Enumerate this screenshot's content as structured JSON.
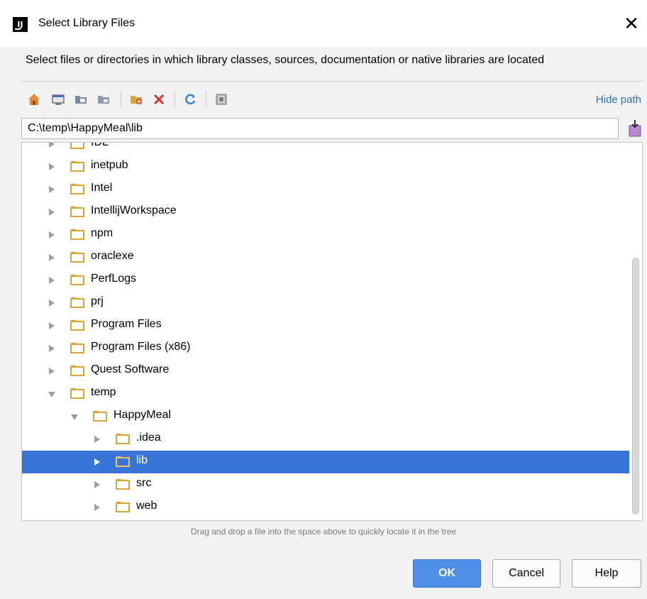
{
  "window": {
    "title": "Select Library Files",
    "app_icon_text": "IJ",
    "close_glyph": "✕"
  },
  "description": "Select files or directories in which library classes, sources, documentation or native libraries are located",
  "toolbar": {
    "icons": [
      "home-icon",
      "desktop-icon",
      "project-folder-icon",
      "module-folder-icon",
      "new-folder-icon",
      "delete-icon",
      "refresh-icon",
      "show-hidden-icon"
    ],
    "hide_path_label": "Hide path"
  },
  "path_field": {
    "value": "C:\\temp\\HappyMeal\\lib"
  },
  "tree": {
    "items": [
      {
        "label": "IDL",
        "level": 1,
        "state": "collapsed",
        "selected": false,
        "partial": true
      },
      {
        "label": "inetpub",
        "level": 1,
        "state": "collapsed",
        "selected": false
      },
      {
        "label": "Intel",
        "level": 1,
        "state": "collapsed",
        "selected": false
      },
      {
        "label": "IntellijWorkspace",
        "level": 1,
        "state": "collapsed",
        "selected": false
      },
      {
        "label": "npm",
        "level": 1,
        "state": "collapsed",
        "selected": false
      },
      {
        "label": "oraclexe",
        "level": 1,
        "state": "collapsed",
        "selected": false
      },
      {
        "label": "PerfLogs",
        "level": 1,
        "state": "collapsed",
        "selected": false
      },
      {
        "label": "prj",
        "level": 1,
        "state": "collapsed",
        "selected": false
      },
      {
        "label": "Program Files",
        "level": 1,
        "state": "collapsed",
        "selected": false
      },
      {
        "label": "Program Files (x86)",
        "level": 1,
        "state": "collapsed",
        "selected": false
      },
      {
        "label": "Quest Software",
        "level": 1,
        "state": "collapsed",
        "selected": false
      },
      {
        "label": "temp",
        "level": 1,
        "state": "expanded",
        "selected": false
      },
      {
        "label": "HappyMeal",
        "level": 2,
        "state": "expanded",
        "selected": false
      },
      {
        "label": ".idea",
        "level": 3,
        "state": "collapsed",
        "selected": false
      },
      {
        "label": "lib",
        "level": 3,
        "state": "collapsed",
        "selected": true
      },
      {
        "label": "src",
        "level": 3,
        "state": "collapsed",
        "selected": false
      },
      {
        "label": "web",
        "level": 3,
        "state": "collapsed",
        "selected": false
      }
    ]
  },
  "hint": "Drag and drop a file into the space above to quickly locate it in the tree",
  "buttons": {
    "ok": "OK",
    "cancel": "Cancel",
    "help": "Help"
  },
  "colors": {
    "selection": "#3875d7",
    "folder": "#d7a73c",
    "link": "#2d6fb7",
    "ok_button": "#4e8ee6"
  }
}
